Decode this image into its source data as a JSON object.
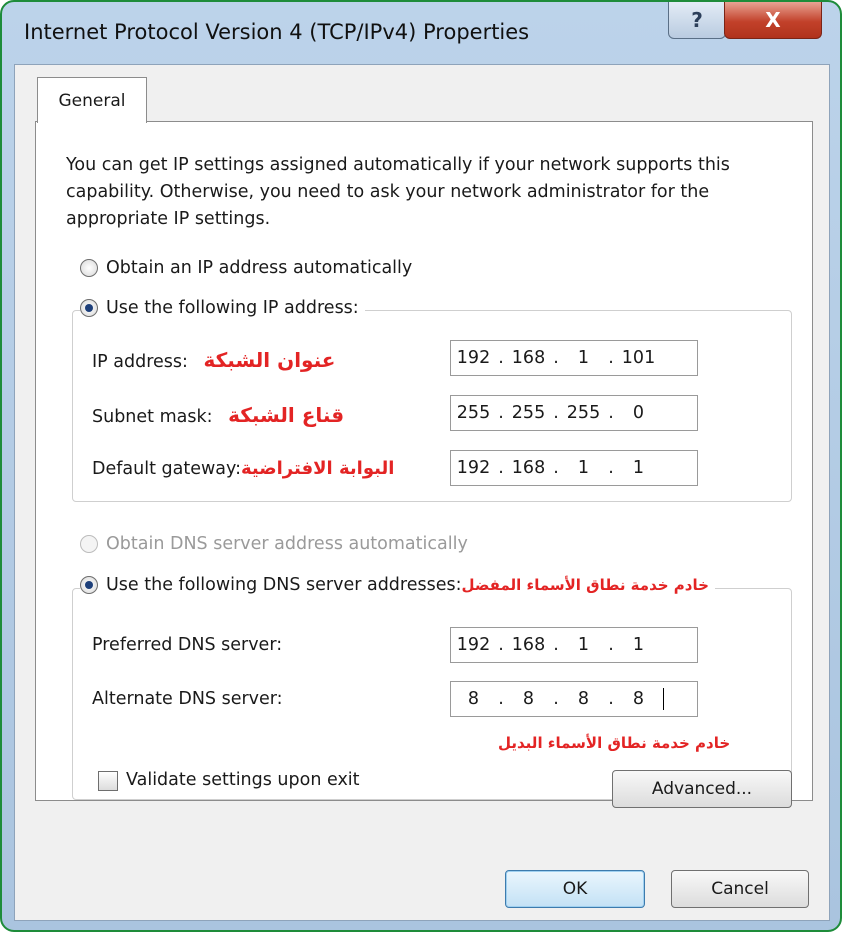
{
  "window": {
    "title": "Internet Protocol Version 4 (TCP/IPv4) Properties",
    "help_label": "?",
    "close_label": "X"
  },
  "tabs": [
    {
      "label": "General",
      "selected": true
    }
  ],
  "intro": "You can get IP settings assigned automatically if your network supports this capability. Otherwise, you need to ask your network administrator for the appropriate IP settings.",
  "ip_mode": {
    "auto_label": "Obtain an IP address automatically",
    "auto_selected": false,
    "manual_label": "Use the following IP address:",
    "manual_selected": true
  },
  "ip_fields": {
    "ip_address": {
      "label": "IP address:",
      "annotation": "عنوان الشبكة",
      "octets": [
        "192",
        "168",
        "1",
        "101"
      ]
    },
    "subnet_mask": {
      "label": "Subnet mask:",
      "annotation": "قناع الشبكة",
      "octets": [
        "255",
        "255",
        "255",
        "0"
      ]
    },
    "default_gateway": {
      "label": "Default gateway:",
      "annotation": "البوابة الافتراضية",
      "octets": [
        "192",
        "168",
        "1",
        "1"
      ]
    }
  },
  "dns_mode": {
    "auto_label": "Obtain DNS server address automatically",
    "auto_selected": false,
    "auto_disabled": true,
    "manual_label": "Use the following DNS server addresses:",
    "manual_selected": true,
    "manual_annotation": "خادم خدمة نطاق الأسماء المفضل"
  },
  "dns_fields": {
    "preferred": {
      "label": "Preferred DNS server:",
      "octets": [
        "192",
        "168",
        "1",
        "1"
      ]
    },
    "alternate": {
      "label": "Alternate DNS server:",
      "octets": [
        "8",
        "8",
        "8",
        "8"
      ],
      "annotation": "خادم خدمة نطاق الأسماء البديل"
    }
  },
  "validate": {
    "label": "Validate settings upon exit",
    "checked": false
  },
  "buttons": {
    "advanced": "Advanced...",
    "ok": "OK",
    "cancel": "Cancel"
  },
  "colors": {
    "annotation": "#e32424",
    "frame_border": "#1e8c3a",
    "titlebar": "#bcd3ea",
    "close_button": "#c2412a"
  }
}
